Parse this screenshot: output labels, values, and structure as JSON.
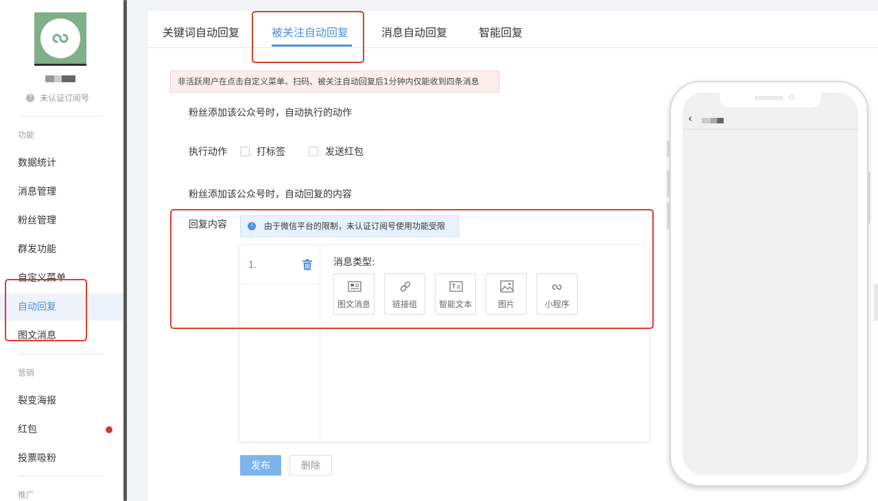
{
  "sidebar": {
    "account_status": "未认证订阅号",
    "sections": [
      {
        "label": "功能"
      },
      {
        "label": "营销"
      },
      {
        "label": "推广"
      }
    ],
    "items": [
      {
        "label": "数据统计"
      },
      {
        "label": "消息管理"
      },
      {
        "label": "粉丝管理"
      },
      {
        "label": "群发功能"
      },
      {
        "label": "自定义菜单"
      },
      {
        "label": "自动回复"
      },
      {
        "label": "图文消息"
      },
      {
        "label": "裂变海报"
      },
      {
        "label": "红包"
      },
      {
        "label": "投票吸粉"
      }
    ]
  },
  "tabs": [
    {
      "label": "关键词自动回复"
    },
    {
      "label": "被关注自动回复"
    },
    {
      "label": "消息自动回复"
    },
    {
      "label": "智能回复"
    }
  ],
  "active_tab": "被关注自动回复",
  "warning": "非活跃用户在点击自定义菜单、扫码、被关注自动回复后1分钟内仅能收到四条消息",
  "action_section_title": "粉丝添加该公众号时，自动执行的动作",
  "action_label": "执行动作",
  "action_options": [
    {
      "label": "打标签",
      "checked": false
    },
    {
      "label": "发送红包",
      "checked": false
    }
  ],
  "reply_section_title": "粉丝添加该公众号时，自动回复的内容",
  "reply_label": "回复内容",
  "info_notice": "由于微信平台的限制，未认证订阅号使用功能受限",
  "editor": {
    "item_number": "1.",
    "message_type_label": "消息类型:",
    "message_types": [
      {
        "label": "图文消息",
        "icon": "article-icon"
      },
      {
        "label": "链接组",
        "icon": "link-icon"
      },
      {
        "label": "智能文本",
        "icon": "text-icon"
      },
      {
        "label": "图片",
        "icon": "image-icon"
      },
      {
        "label": "小程序",
        "icon": "miniprogram-icon"
      }
    ]
  },
  "buttons": {
    "publish": "发布",
    "delete": "删除"
  },
  "colors": {
    "accent": "#4a8fe0",
    "annotation": "#e0392b",
    "logo_bg": "#7fb08a",
    "red_dot": "#d8372a"
  }
}
